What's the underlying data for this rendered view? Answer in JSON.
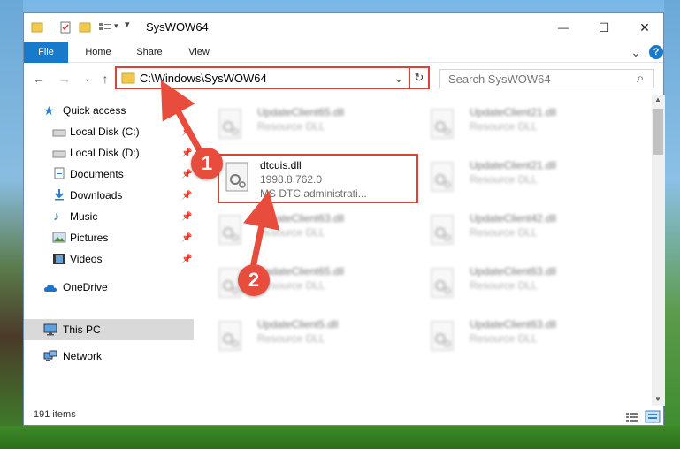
{
  "window": {
    "title": "SysWOW64",
    "controls": {
      "minimize": "—",
      "maximize": "☐",
      "close": "✕"
    }
  },
  "ribbon": {
    "tabs": [
      "File",
      "Home",
      "Share",
      "View"
    ],
    "expand_glyph": "⌄",
    "help_glyph": "?"
  },
  "navigation": {
    "back": "←",
    "forward": "→",
    "recent": "⌄",
    "up": "↑",
    "address": "C:\\Windows\\SysWOW64",
    "address_dropdown": "⌄",
    "refresh": "↻",
    "search_placeholder": "Search SysWOW64",
    "search_glyph": "⌕"
  },
  "sidebar": {
    "items": [
      {
        "label": "Quick access",
        "icon": "star-icon",
        "pinned": false
      },
      {
        "label": "Local Disk (C:)",
        "icon": "drive-icon",
        "pinned": true
      },
      {
        "label": "Local Disk (D:)",
        "icon": "drive-icon",
        "pinned": true
      },
      {
        "label": "Documents",
        "icon": "documents-icon",
        "pinned": true
      },
      {
        "label": "Downloads",
        "icon": "download-icon",
        "pinned": true
      },
      {
        "label": "Music",
        "icon": "music-icon",
        "pinned": true
      },
      {
        "label": "Pictures",
        "icon": "pictures-icon",
        "pinned": true
      },
      {
        "label": "Videos",
        "icon": "videos-icon",
        "pinned": true
      },
      {
        "label": "OneDrive",
        "icon": "cloud-icon",
        "pinned": false
      },
      {
        "label": "This PC",
        "icon": "computer-icon",
        "pinned": false,
        "selected": true
      },
      {
        "label": "Network",
        "icon": "network-icon",
        "pinned": false
      }
    ],
    "pin_glyph": "📌"
  },
  "files": {
    "highlighted": {
      "name": "dtcuis.dll",
      "version": "1998.8.762.0",
      "description": "MS DTC administrati..."
    },
    "background": [
      {
        "name": "UpdateClient65.dll",
        "type": "Resource DLL"
      },
      {
        "name": "UpdateClient21.dll",
        "type": "Resource DLL"
      },
      {
        "name": "UpdateClient21.dll",
        "type": "Resource DLL"
      },
      {
        "name": "UpdateClient63.dll",
        "type": "Resource DLL"
      },
      {
        "name": "UpdateClient42.dll",
        "type": "Resource DLL"
      },
      {
        "name": "UpdateClient65.dll",
        "type": "Resource DLL"
      },
      {
        "name": "UpdateClient63.dll",
        "type": "Resource DLL"
      },
      {
        "name": "UpdateClient5.dll",
        "type": "Resource DLL"
      },
      {
        "name": "UpdateClient63.dll",
        "type": "Resource DLL"
      }
    ]
  },
  "status": {
    "items_count": "191 items"
  },
  "callouts": [
    "1",
    "2"
  ],
  "colors": {
    "accent": "#1979ca",
    "highlight_red": "#d9443a",
    "callout_red": "#e74c3c"
  }
}
